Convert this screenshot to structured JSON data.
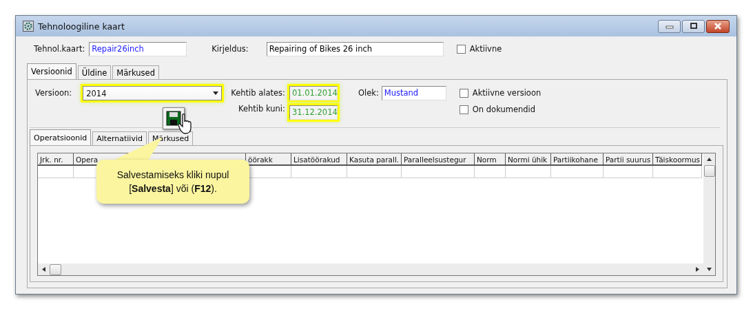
{
  "window": {
    "title": "Tehnoloogiline kaart"
  },
  "header": {
    "fields": [
      {
        "label": "Tehnol.kaart:",
        "value": "Repair26inch",
        "color": "#1a1aff"
      },
      {
        "label": "Kirjeldus:",
        "value": "Repairing of Bikes 26 inch",
        "color": "#000000"
      }
    ],
    "checkbox": {
      "label": "Aktiivne",
      "checked": false
    }
  },
  "tabs": [
    {
      "label": "Versioonid",
      "selected": true
    },
    {
      "label": "Üldine",
      "selected": false
    },
    {
      "label": "Märkused",
      "selected": false
    }
  ],
  "version": {
    "version_label": "Versioon:",
    "version_value": "2014",
    "version_highlighted": true,
    "valid_from_label": "Kehtib alates:",
    "valid_from": "01.01.2014",
    "valid_to_label": "Kehtib kuni:",
    "valid_to": "31.12.2014",
    "dates_highlighted": true,
    "status_label": "Olek:",
    "status": "Mustand",
    "checkboxes": [
      {
        "label": "Aktiivne versioon",
        "checked": false
      },
      {
        "label": "On dokumendid",
        "checked": false
      }
    ]
  },
  "subtabs": [
    {
      "label": "Operatsioonid",
      "selected": true
    },
    {
      "label": "Alternatiivid",
      "selected": false
    },
    {
      "label": "Märkused",
      "selected": false
    }
  ],
  "table": {
    "columns": [
      {
        "label": "Jrk. nr."
      },
      {
        "label": "Opera"
      },
      {},
      {
        "label": "öörakk"
      },
      {
        "label": "Lisatöörakud"
      },
      {
        "label": "Kasuta parall."
      },
      {
        "label": "Paralleelsustegur"
      },
      {
        "label": "Norm"
      },
      {
        "label": "Normi ühik"
      },
      {
        "label": "Partiikohane"
      },
      {
        "label": "Partii suurus"
      },
      {
        "label": "Täiskoormus"
      }
    ]
  },
  "callout": {
    "lines": [
      "Salvestamiseks kliki nupul",
      "[**Salvesta**] või (**F12**)."
    ]
  }
}
